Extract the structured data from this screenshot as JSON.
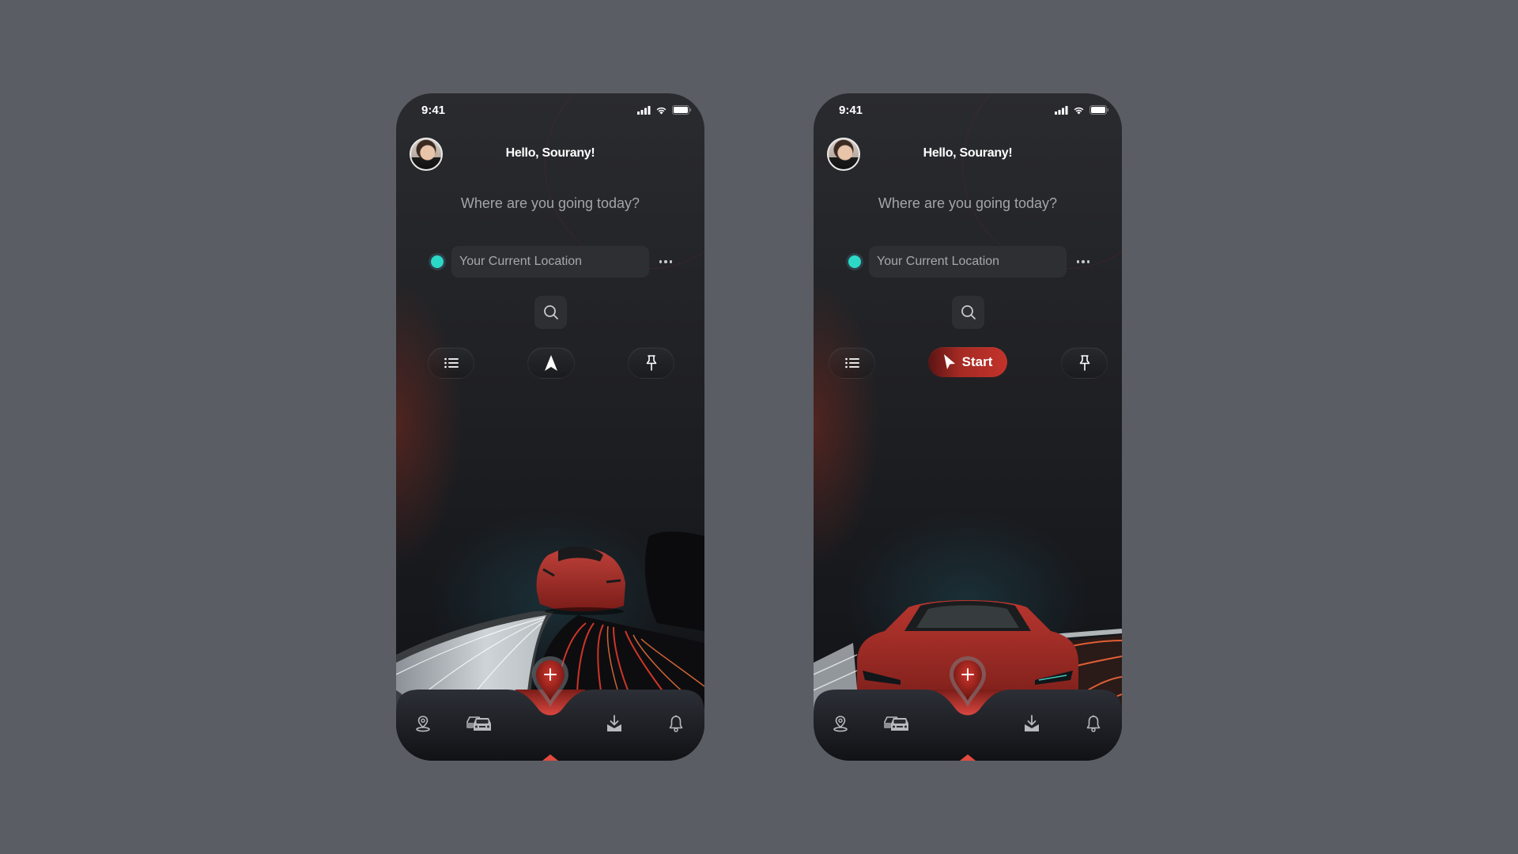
{
  "screens": [
    {
      "id": "phone1",
      "status_bar": {
        "time": "9:41",
        "icons": [
          "signal-icon",
          "wifi-icon",
          "battery-icon"
        ]
      },
      "header": {
        "greeting": "Hello, Sourany!",
        "avatar": "user-avatar"
      },
      "subtitle": "Where are you going today?",
      "location": {
        "value": "Your Current Location",
        "placeholder": "Your Current Location",
        "dot_color": "#2bd9c6"
      },
      "actions": {
        "list_icon": "list-icon",
        "center": {
          "type": "icon",
          "icon": "navigation-arrow-icon",
          "label": ""
        },
        "pin_icon": "pushpin-icon"
      },
      "hero_image": "red sports car on curved highway with light trails",
      "bottom_nav": {
        "items": [
          {
            "icon": "location-pin-icon",
            "label": "Location"
          },
          {
            "icon": "cars-icon",
            "label": "Vehicles"
          },
          {
            "icon": "add-location-fab-icon",
            "label": "Add"
          },
          {
            "icon": "download-tray-icon",
            "label": "Downloads"
          },
          {
            "icon": "bell-icon",
            "label": "Notifications"
          }
        ]
      }
    },
    {
      "id": "phone2",
      "status_bar": {
        "time": "9:41",
        "icons": [
          "signal-icon",
          "wifi-icon",
          "battery-icon"
        ]
      },
      "header": {
        "greeting": "Hello, Sourany!",
        "avatar": "user-avatar"
      },
      "subtitle": "Where are you going today?",
      "location": {
        "value": "Your Current Location",
        "placeholder": "Your Current Location",
        "dot_color": "#2bd9c6"
      },
      "actions": {
        "list_icon": "list-icon",
        "center": {
          "type": "button",
          "icon": "cursor-arrow-icon",
          "label": "Start"
        },
        "pin_icon": "pushpin-icon"
      },
      "hero_image": "red sports car front view with light trails",
      "bottom_nav": {
        "items": [
          {
            "icon": "location-pin-icon",
            "label": "Location"
          },
          {
            "icon": "cars-icon",
            "label": "Vehicles"
          },
          {
            "icon": "add-location-fab-icon",
            "label": "Add"
          },
          {
            "icon": "download-tray-icon",
            "label": "Downloads"
          },
          {
            "icon": "bell-icon",
            "label": "Notifications"
          }
        ]
      }
    }
  ],
  "colors": {
    "background": "#5a5d64",
    "accent_red": "#c2332b",
    "location_dot": "#2bd9c6",
    "phone_bg": "#1f2023"
  }
}
